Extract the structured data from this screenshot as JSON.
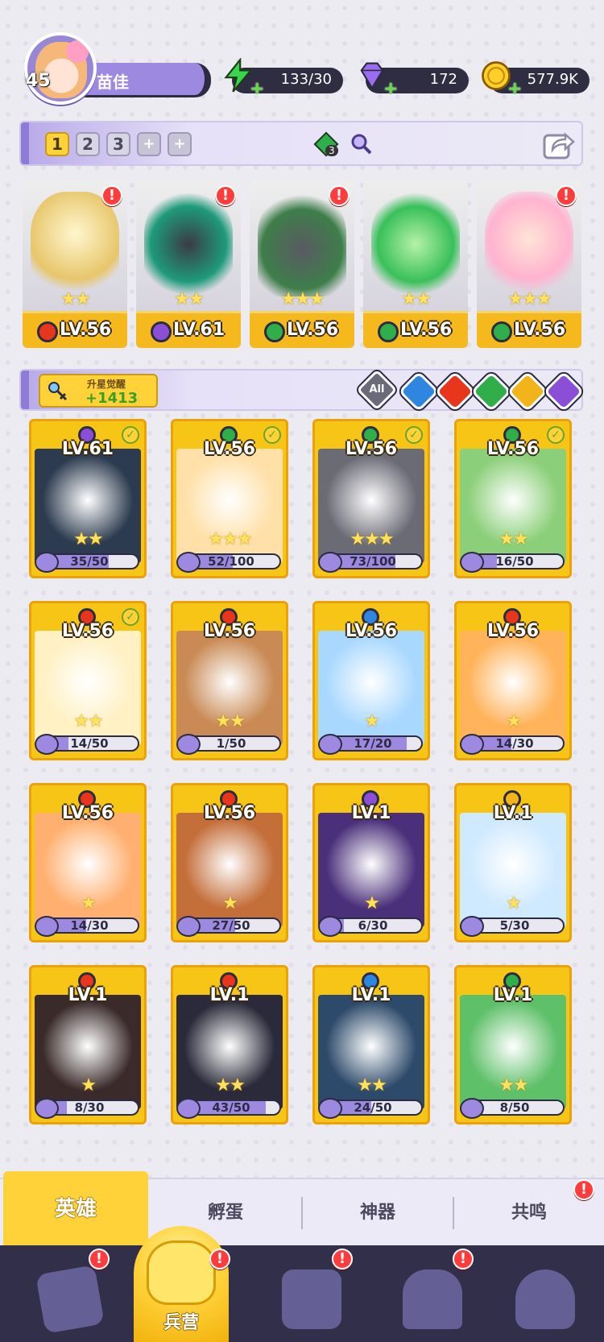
{
  "player": {
    "level": "45",
    "name": "苗佳"
  },
  "resources": {
    "energy": "133/30",
    "gems": "172",
    "gold": "577.9K"
  },
  "team_bar": {
    "slots": [
      "1",
      "2",
      "3",
      "+",
      "+"
    ],
    "active_slot": "1",
    "element_gem_count": "3"
  },
  "team": [
    {
      "level": "LV.56",
      "element": "fire",
      "stars": "★★",
      "alert": "!"
    },
    {
      "level": "LV.61",
      "element": "dark",
      "stars": "★★",
      "alert": "!"
    },
    {
      "level": "LV.56",
      "element": "nature",
      "stars": "★★★",
      "alert": "!"
    },
    {
      "level": "LV.56",
      "element": "nature",
      "stars": "★★",
      "alert": ""
    },
    {
      "level": "LV.56",
      "element": "nature",
      "stars": "★★★",
      "alert": "!"
    }
  ],
  "filter_bar": {
    "key_label": "升星觉醒",
    "key_value": "+1413",
    "all_label": "All",
    "elements": [
      "water",
      "fire",
      "nature",
      "light",
      "dark"
    ]
  },
  "roster": [
    {
      "level": "LV.61",
      "element": "dark",
      "stars": "★★",
      "progress": "35/50",
      "checked": true
    },
    {
      "level": "LV.56",
      "element": "nature",
      "stars": "★★★",
      "progress": "52/100",
      "checked": true
    },
    {
      "level": "LV.56",
      "element": "nature",
      "stars": "★★★",
      "progress": "73/100",
      "checked": true
    },
    {
      "level": "LV.56",
      "element": "nature",
      "stars": "★★",
      "progress": "16/50",
      "checked": true
    },
    {
      "level": "LV.56",
      "element": "fire",
      "stars": "★★",
      "progress": "14/50",
      "checked": true
    },
    {
      "level": "LV.56",
      "element": "fire",
      "stars": "★★",
      "progress": "1/50",
      "checked": false
    },
    {
      "level": "LV.56",
      "element": "water",
      "stars": "★",
      "progress": "17/20",
      "checked": false
    },
    {
      "level": "LV.56",
      "element": "fire",
      "stars": "★",
      "progress": "14/30",
      "checked": false
    },
    {
      "level": "LV.56",
      "element": "fire",
      "stars": "★",
      "progress": "14/30",
      "checked": false
    },
    {
      "level": "LV.56",
      "element": "fire",
      "stars": "★",
      "progress": "27/50",
      "checked": false
    },
    {
      "level": "LV.1",
      "element": "dark",
      "stars": "★",
      "progress": "6/30",
      "checked": false
    },
    {
      "level": "LV.1",
      "element": "light",
      "stars": "★",
      "progress": "5/30",
      "checked": false
    },
    {
      "level": "LV.1",
      "element": "fire",
      "stars": "★",
      "progress": "8/30",
      "checked": false
    },
    {
      "level": "LV.1",
      "element": "fire",
      "stars": "★★",
      "progress": "43/50",
      "checked": false
    },
    {
      "level": "LV.1",
      "element": "water",
      "stars": "★★",
      "progress": "24/50",
      "checked": false
    },
    {
      "level": "LV.1",
      "element": "nature",
      "stars": "★★",
      "progress": "8/50",
      "checked": false
    }
  ],
  "sub_tabs": [
    "英雄",
    "孵蛋",
    "神器",
    "共鸣"
  ],
  "bottom_nav": {
    "active_label": "兵营"
  },
  "colors": {
    "fire": "#e8361c",
    "dark": "#8a4fd6",
    "nature": "#2fae4a",
    "water": "#2f86e0",
    "light": "#f2b41a",
    "accent": "#ffd23a",
    "nav": "#312f4a"
  }
}
